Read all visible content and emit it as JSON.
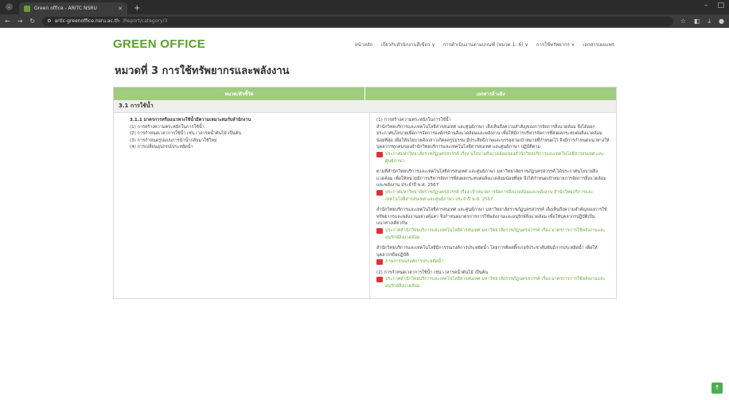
{
  "browser": {
    "tab_title": "Green office - ARITC NSRU",
    "url_host": "aritc-greenoffice.nsru.ac.th",
    "url_path": "/Report/category/3"
  },
  "site": {
    "logo": "GREEN OFFICE",
    "menu": [
      "หน้าหลัก",
      "เกี่ยวกับสำนักงานสีเขียว ∨",
      "การดำเนินงานตามเกณฑ์ (หมวด 1- 6) ∨",
      "การใช้ทรัพยากร ∨",
      "เอกสารเผยแพร่"
    ]
  },
  "page_title": "หมวดที่ 3 การใช้ทรัพยากรและพลังงาน",
  "table": {
    "col_left": "หมวด/ตัวชี้วัด",
    "col_right": "เอกสารอ้างอิง",
    "section": "3.1 การใช้น้ำ",
    "indicator_title": "3.1.1 มาตรการหรือแนวทางใช้น้ำมีความเหมาะสมกับสำนักงาน",
    "indicator_items": [
      "(1) การสร้างความตระหนักในการใช้น้ำ",
      "(2) การกำหนดเวลาการใช้น้ำ เช่น เวลารดน้ำต้นไม้ เป็นต้น",
      "(3) การกำหนดรูปแบบการนำน้ำกลับมาใช้ใหม่",
      "(4) การเปลี่ยนอุปกรณ์ประหยัดน้ำ"
    ],
    "refs": [
      {
        "type": "text",
        "text": "(1) การสร้างความตระหนักในการใช้น้ำ"
      },
      {
        "type": "text",
        "text": "สำนักวิทยบริการและเทคโนโลยีสารสนเทศ และศูนย์ภาษา เล็งเห็นถึงความสำคัญของการจัดการสิ่งแวดล้อม จึงได้ออกประกาศนโยบายเพื่อการจัดการองค์กรด้านสิ่งแวดล้อมและพลังงาน เพื่อให้มีการบริหารจัดการที่ส่งผลกระทบต่อสิ่งแวดล้อมน้อยที่สุด เพื่อให้นโยบายดังกล่าวเกิดผลรูปธรรม มีประสิทธิภาพและบรรลุตามเป้าหมายที่กำหนดไว้ จึงมีการกำหนดแนวทางให้บุคลากรทุกคนของสำนักวิทยบริการและเทคโนโลยีสารสนเทศ และศูนย์ภาษา ปฏิบัติตาม"
      },
      {
        "type": "doc",
        "text": "ประกาศมหาวิทยาลัยราชภัฏนครสวรรค์ เรื่อง นโยบายสิ่งแวดล้อมของสำนักวิทยบริการและเทคโนโลยีสารสนเทศ และศูนย์ภาษา"
      },
      {
        "type": "text",
        "text": "ตามที่สำนักวิทยบริการและเทคโนโลยีสารสนเทศ และศูนย์ภาษา มหาวิทยาลัยราชภัฏนครสวรรค์ ได้ประกาศนโยบายสิ่งแวดล้อม เพื่อให้หน่วยมีการบริหารจัดการที่ส่งผลกระทบต่อสิ่งแวดล้อมน้อยที่สุด จึงได้กำหนดเป้าหมายการจัดการสิ่งแวดล้อมและพลังงาน ประจำปี พ.ศ. 2567"
      },
      {
        "type": "doc",
        "text": "ประกาศมหาวิทยาลัยราชภัฏนครสวรรค์ เรื่อง เป้าหมายการจัดการสิ่งแวดล้อมและพลังงาน สำนักวิทยบริการและเทคโนโลยีสารสนเทศ และศูนย์ภาษา ประจำปี พ.ศ. 2567"
      },
      {
        "type": "text",
        "text": "สำนักวิทยบริการและเทคโนโลยีสารสนเทศ และศูนย์ภาษา มหาวิทยาลัยราชภัฏนครสวรรค์ เล็งเห็นถึงความสำคัญของการใช้ทรัพยากรและพลังงานอย่างคุ้มค่า จึงกำหนดมาตรการการใช้พลังงานและอนุรักษ์สิ่งแวดล้อม เพื่อให้บุคลากรปฏิบัติเป็นแนวทางเดียวกัน"
      },
      {
        "type": "doc",
        "text": "ประกาศสำนักวิทยบริการและเทคโนโลยีสารสนเทศ มหาวิทยาลัยราชภัฏนครสวรรค์ เรื่อง มาตรการการใช้พลังงานและอนุรักษ์สิ่งแวดล้อม"
      },
      {
        "type": "text",
        "text": "สำนักวิทยบริการและเทคโนโลยีมีการรณรงค์การประหยัดน้ำ โดยการติดสติ๊กเกอร์ประชาสัมพันธ์การประหยัดน้ำ เพื่อให้บุคลากรถือปฏิบัติ"
      },
      {
        "type": "doc",
        "text": "ภาพการรณรงค์การประหยัดน้ำ"
      },
      {
        "type": "text",
        "text": "(2) การกำหนดเวลาการใช้น้ำ เช่น เวลารดน้ำต้นไม้ เป็นต้น"
      },
      {
        "type": "doc",
        "text": "ประกาศสำนักวิทยบริการและเทคโนโลยีสารสนเทศ มหาวิทยาลัยราชภัฏนครสวรรค์ เรื่อง มาตรการการใช้พลังงานและอนุรักษ์สิ่งแวดล้อม"
      }
    ]
  },
  "colors": {
    "accent": "#5aa12e",
    "header_bg": "#9fcc7e",
    "link": "#6aac3a"
  }
}
